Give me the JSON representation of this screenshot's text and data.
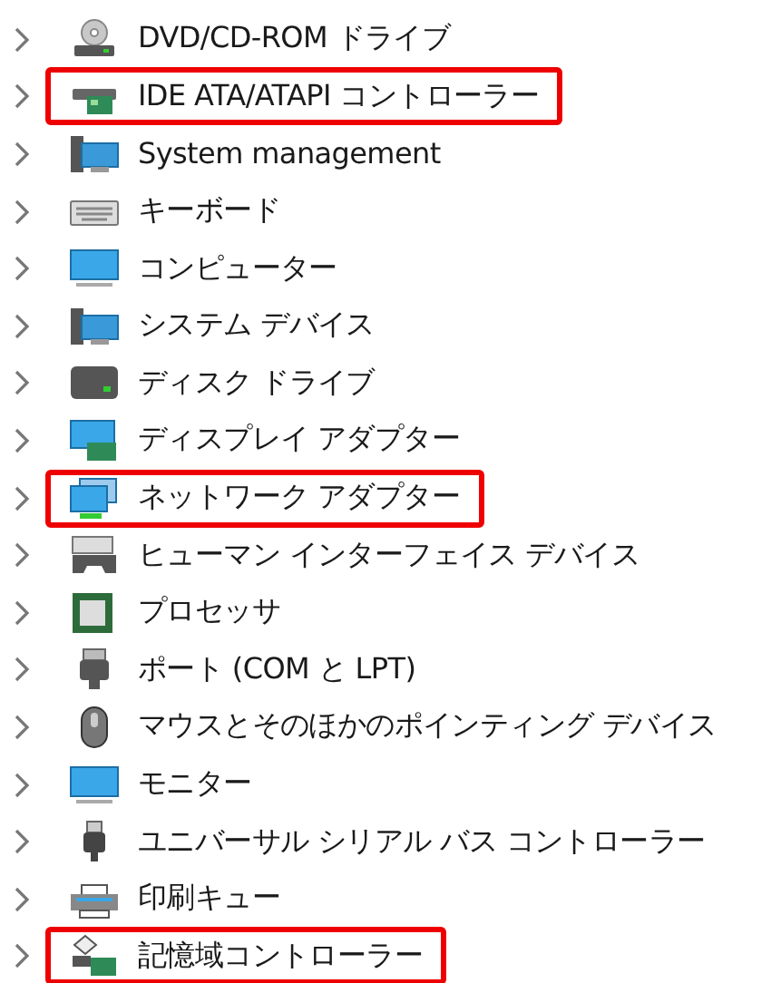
{
  "device_tree": {
    "items": [
      {
        "label": "DVD/CD-ROM ドライブ",
        "kind": "optical",
        "expanded": false,
        "highlighted": false
      },
      {
        "label": "IDE ATA/ATAPI コントローラー",
        "kind": "controller",
        "expanded": false,
        "highlighted": true
      },
      {
        "label": "System management",
        "kind": "system",
        "expanded": false,
        "highlighted": false
      },
      {
        "label": "キーボード",
        "kind": "keyboard",
        "expanded": false,
        "highlighted": false
      },
      {
        "label": "コンピューター",
        "kind": "monitor",
        "expanded": false,
        "highlighted": false
      },
      {
        "label": "システム デバイス",
        "kind": "system",
        "expanded": false,
        "highlighted": false
      },
      {
        "label": "ディスク ドライブ",
        "kind": "disk",
        "expanded": false,
        "highlighted": false
      },
      {
        "label": "ディスプレイ アダプター",
        "kind": "display",
        "expanded": false,
        "highlighted": false
      },
      {
        "label": "ネットワーク アダプター",
        "kind": "network",
        "expanded": false,
        "highlighted": true
      },
      {
        "label": "ヒューマン インターフェイス デバイス",
        "kind": "hid",
        "expanded": false,
        "highlighted": false
      },
      {
        "label": "プロセッサ",
        "kind": "processor",
        "expanded": false,
        "highlighted": false
      },
      {
        "label": "ポート (COM と LPT)",
        "kind": "port",
        "expanded": false,
        "highlighted": false
      },
      {
        "label": "マウスとそのほかのポインティング デバイス",
        "kind": "mouse",
        "expanded": false,
        "highlighted": false
      },
      {
        "label": "モニター",
        "kind": "monitor",
        "expanded": false,
        "highlighted": false
      },
      {
        "label": "ユニバーサル シリアル バス コントローラー",
        "kind": "usb",
        "expanded": false,
        "highlighted": false
      },
      {
        "label": "印刷キュー",
        "kind": "printer",
        "expanded": false,
        "highlighted": false
      },
      {
        "label": "記憶域コントローラー",
        "kind": "storage",
        "expanded": false,
        "highlighted": true
      }
    ]
  }
}
